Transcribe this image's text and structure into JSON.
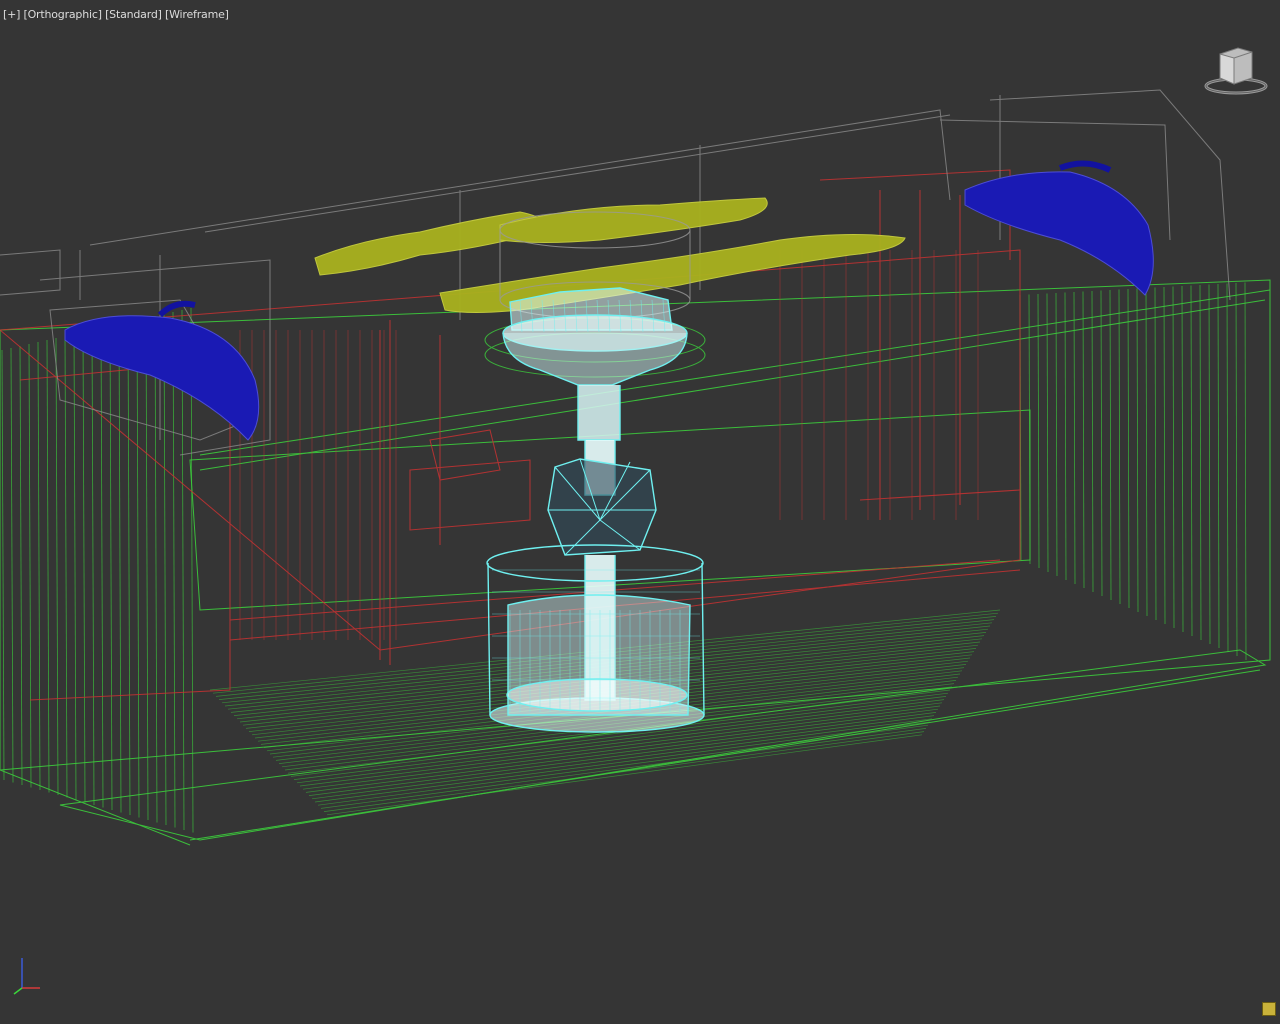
{
  "viewport": {
    "label_parts": [
      "[+]",
      "[Orthographic]",
      "[Standard]",
      "[Wireframe]"
    ]
  },
  "colors": {
    "background": "#353535",
    "enclosure_wire": "#3ccd3c",
    "inner_frame_wire": "#c83232",
    "selected_wire": "#6ff0f0",
    "fan_blades": "#1a1ab4",
    "cable_mesh": "#a9b21e",
    "housing_wire": "#8c8c8c"
  },
  "icons": {
    "viewcube": "viewcube-icon",
    "axis_tripod": "axis-tripod-icon",
    "corner_button": "mini-curve-editor-icon"
  }
}
